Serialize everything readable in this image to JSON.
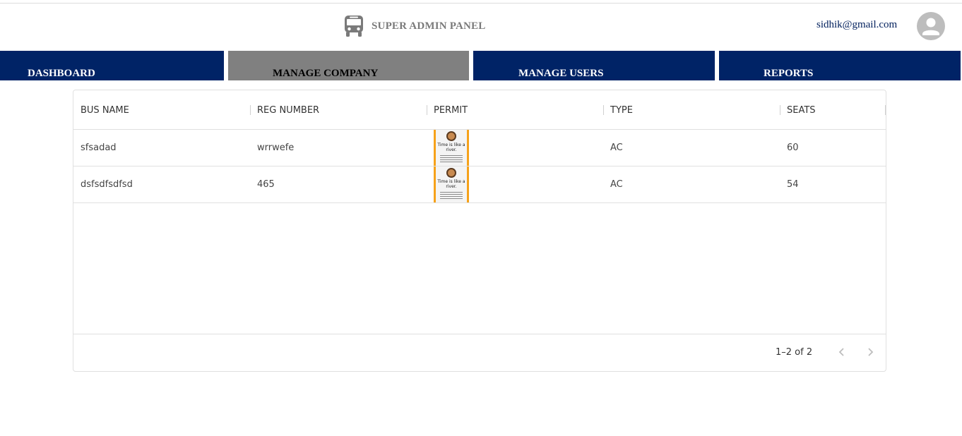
{
  "header": {
    "brand_icon": "bus-icon",
    "title": "SUPER ADMIN PANEL",
    "user_email": "sidhik@gmail.com",
    "avatar_icon": "person-icon"
  },
  "nav": {
    "tabs": [
      {
        "label": "DASHBOARD",
        "active": false
      },
      {
        "label": "MANAGE COMPANY",
        "active": true
      },
      {
        "label": "MANAGE USERS",
        "active": false
      },
      {
        "label": "REPORTS",
        "active": false
      }
    ]
  },
  "colors": {
    "nav_background": "#002366",
    "nav_active_background": "#808080",
    "permit_border": "#f6a21a"
  },
  "table": {
    "columns": [
      "BUS NAME",
      "REG NUMBER",
      "PERMIT",
      "TYPE",
      "SEATS"
    ],
    "rows": [
      {
        "bus_name": "sfsadad",
        "reg_number": "wrrwefe",
        "permit_text": "Time is like a river.",
        "type": "AC",
        "seats": "60"
      },
      {
        "bus_name": "dsfsdfsdfsd",
        "reg_number": "465",
        "permit_text": "Time is like a river.",
        "type": "AC",
        "seats": "54"
      }
    ],
    "pagination": {
      "range_text": "1–2 of 2",
      "prev_icon": "chevron-left-icon",
      "next_icon": "chevron-right-icon"
    }
  }
}
